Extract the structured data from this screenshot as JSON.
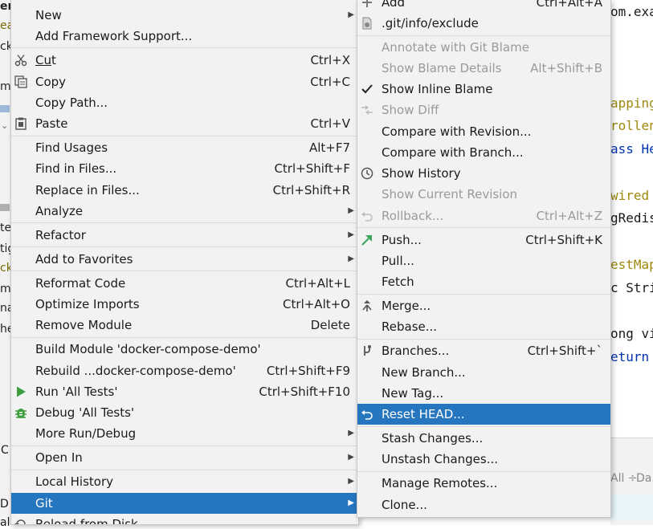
{
  "background": {
    "project_fragments": [
      "er-",
      "ea",
      "ck",
      "m",
      "te",
      "tig",
      "ck",
      "m",
      "nal",
      "he",
      "C",
      "D",
      "al"
    ],
    "code_fragments": [
      {
        "text": "om.exa",
        "color": "#1a1a1a"
      },
      {
        "text": "apping",
        "color": "#9e880d"
      },
      {
        "text": "rollen",
        "color": "#9e880d"
      },
      {
        "text": "ass He",
        "color": "#0033b3"
      },
      {
        "text": "wired",
        "color": "#9e880d"
      },
      {
        "text": "gRedis",
        "color": "#1a1a1a"
      },
      {
        "text": "estMap",
        "color": "#9e880d"
      },
      {
        "text": "c Stri",
        "color": "#1a1a1a"
      },
      {
        "text": "ong vi",
        "color": "#1a1a1a"
      },
      {
        "text": "eturn",
        "color": "#0033b3"
      }
    ],
    "bottom_fragments": [
      "All ÷",
      "Da"
    ]
  },
  "main_menu": {
    "items": [
      {
        "label": "New",
        "shortcut": "",
        "submenu": true,
        "icon": ""
      },
      {
        "label": "Add Framework Support...",
        "shortcut": "",
        "submenu": false,
        "icon": ""
      },
      {
        "label": "Cut",
        "shortcut": "Ctrl+X",
        "submenu": false,
        "icon": "scissors-icon"
      },
      {
        "label": "Copy",
        "shortcut": "Ctrl+C",
        "submenu": false,
        "icon": "copy-icon"
      },
      {
        "label": "Copy Path...",
        "shortcut": "",
        "submenu": false,
        "icon": ""
      },
      {
        "label": "Paste",
        "shortcut": "Ctrl+V",
        "submenu": false,
        "icon": "paste-icon"
      },
      {
        "label": "Find Usages",
        "shortcut": "Alt+F7",
        "submenu": false,
        "icon": ""
      },
      {
        "label": "Find in Files...",
        "shortcut": "Ctrl+Shift+F",
        "submenu": false,
        "icon": ""
      },
      {
        "label": "Replace in Files...",
        "shortcut": "Ctrl+Shift+R",
        "submenu": false,
        "icon": ""
      },
      {
        "label": "Analyze",
        "shortcut": "",
        "submenu": true,
        "icon": ""
      },
      {
        "label": "Refactor",
        "shortcut": "",
        "submenu": true,
        "icon": ""
      },
      {
        "label": "Add to Favorites",
        "shortcut": "",
        "submenu": true,
        "icon": ""
      },
      {
        "label": "Reformat Code",
        "shortcut": "Ctrl+Alt+L",
        "submenu": false,
        "icon": ""
      },
      {
        "label": "Optimize Imports",
        "shortcut": "Ctrl+Alt+O",
        "submenu": false,
        "icon": ""
      },
      {
        "label": "Remove Module",
        "shortcut": "Delete",
        "submenu": false,
        "icon": ""
      },
      {
        "label": "Build Module 'docker-compose-demo'",
        "shortcut": "",
        "submenu": false,
        "icon": ""
      },
      {
        "label": "Rebuild ...docker-compose-demo'",
        "shortcut": "Ctrl+Shift+F9",
        "submenu": false,
        "icon": ""
      },
      {
        "label": "Run 'All Tests'",
        "shortcut": "Ctrl+Shift+F10",
        "submenu": false,
        "icon": "run-icon"
      },
      {
        "label": "Debug 'All Tests'",
        "shortcut": "",
        "submenu": false,
        "icon": "debug-icon"
      },
      {
        "label": "More Run/Debug",
        "shortcut": "",
        "submenu": true,
        "icon": ""
      },
      {
        "label": "Open In",
        "shortcut": "",
        "submenu": true,
        "icon": ""
      },
      {
        "label": "Local History",
        "shortcut": "",
        "submenu": true,
        "icon": ""
      },
      {
        "label": "Git",
        "shortcut": "",
        "submenu": true,
        "icon": "",
        "selected": true
      },
      {
        "label": "Reload from Disk",
        "shortcut": "",
        "submenu": false,
        "icon": "reload-icon"
      }
    ]
  },
  "git_menu": {
    "items": [
      {
        "label": "Add",
        "shortcut": "Ctrl+Alt+A",
        "icon": "plus-icon",
        "disabled": false
      },
      {
        "label": ".git/info/exclude",
        "shortcut": "",
        "icon": "file-icon",
        "disabled": false
      },
      {
        "label": "Annotate with Git Blame",
        "shortcut": "",
        "icon": "",
        "disabled": true
      },
      {
        "label": "Show Blame Details",
        "shortcut": "Alt+Shift+B",
        "icon": "",
        "disabled": true
      },
      {
        "label": "Show Inline Blame",
        "shortcut": "",
        "icon": "check-icon",
        "disabled": false
      },
      {
        "label": "Show Diff",
        "shortcut": "",
        "icon": "diff-icon",
        "disabled": true
      },
      {
        "label": "Compare with Revision...",
        "shortcut": "",
        "icon": "",
        "disabled": false
      },
      {
        "label": "Compare with Branch...",
        "shortcut": "",
        "icon": "",
        "disabled": false
      },
      {
        "label": "Show History",
        "shortcut": "",
        "icon": "clock-icon",
        "disabled": false
      },
      {
        "label": "Show Current Revision",
        "shortcut": "",
        "icon": "",
        "disabled": true
      },
      {
        "label": "Rollback...",
        "shortcut": "Ctrl+Alt+Z",
        "icon": "undo-icon",
        "disabled": true
      },
      {
        "label": "Push...",
        "shortcut": "Ctrl+Shift+K",
        "icon": "push-arrow-icon",
        "disabled": false
      },
      {
        "label": "Pull...",
        "shortcut": "",
        "icon": "",
        "disabled": false
      },
      {
        "label": "Fetch",
        "shortcut": "",
        "icon": "",
        "disabled": false
      },
      {
        "label": "Merge...",
        "shortcut": "",
        "icon": "merge-icon",
        "disabled": false
      },
      {
        "label": "Rebase...",
        "shortcut": "",
        "icon": "",
        "disabled": false
      },
      {
        "label": "Branches...",
        "shortcut": "Ctrl+Shift+`",
        "icon": "branch-icon",
        "disabled": false
      },
      {
        "label": "New Branch...",
        "shortcut": "",
        "icon": "",
        "disabled": false
      },
      {
        "label": "New Tag...",
        "shortcut": "",
        "icon": "",
        "disabled": false
      },
      {
        "label": "Reset HEAD...",
        "shortcut": "",
        "icon": "reset-icon",
        "disabled": false,
        "selected": true
      },
      {
        "label": "Stash Changes...",
        "shortcut": "",
        "icon": "",
        "disabled": false
      },
      {
        "label": "Unstash Changes...",
        "shortcut": "",
        "icon": "",
        "disabled": false
      },
      {
        "label": "Manage Remotes...",
        "shortcut": "",
        "icon": "",
        "disabled": false
      },
      {
        "label": "Clone...",
        "shortcut": "",
        "icon": "",
        "disabled": false
      }
    ]
  },
  "colors": {
    "selection": "#2675bf",
    "menu_bg": "#f2f2f2",
    "disabled_text": "#9a9a9a",
    "run_green": "#3c9e3c",
    "push_green": "#3aa55c"
  }
}
